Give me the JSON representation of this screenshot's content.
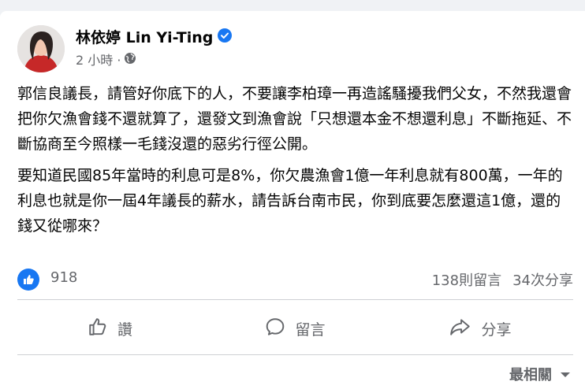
{
  "post": {
    "author": "林依婷 Lin Yi-Ting",
    "time": "2 小時 ·",
    "paragraphs": [
      "郭信良議長，請管好你底下的人，不要讓李柏璋一再造謠騷擾我們父女，不然我還會把你欠漁會錢不還就算了，還發文到漁會說「只想還本金不想還利息」不斷拖延、不斷協商至今照樣一毛錢沒還的惡劣行徑公開。",
      "要知道民國85年當時的利息可是8%，你欠農漁會1億一年利息就有800萬，一年的利息也就是你一屆4年議長的薪水，請告訴台南市民，你到底要怎麼還這1億，還的錢又從哪來？"
    ],
    "likes": "918",
    "comments": "138則留言",
    "shares": "34次分享"
  },
  "actions": {
    "like": "讚",
    "comment": "留言",
    "share": "分享"
  },
  "sort": {
    "label": "最相關"
  },
  "colors": {
    "accent": "#1877f2",
    "muted": "#65676b"
  }
}
